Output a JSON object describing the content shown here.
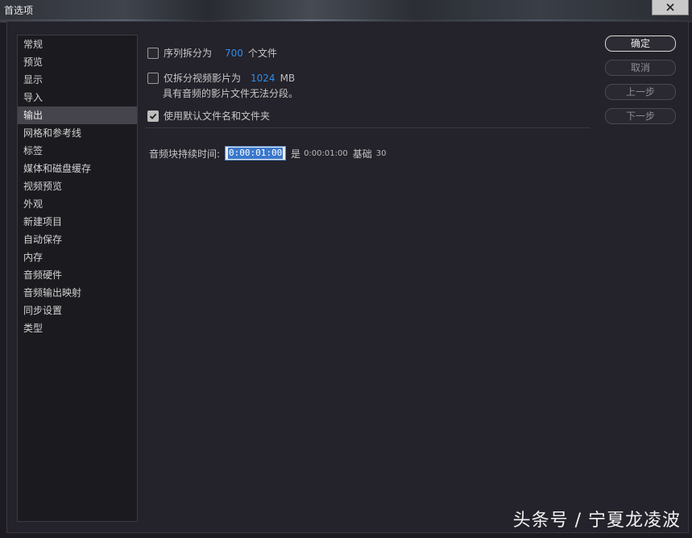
{
  "window": {
    "title": "首选项"
  },
  "sidebar": {
    "items": [
      {
        "label": "常规"
      },
      {
        "label": "预览"
      },
      {
        "label": "显示"
      },
      {
        "label": "导入"
      },
      {
        "label": "输出"
      },
      {
        "label": "网格和参考线"
      },
      {
        "label": "标签"
      },
      {
        "label": "媒体和磁盘缓存"
      },
      {
        "label": "视频预览"
      },
      {
        "label": "外观"
      },
      {
        "label": "新建项目"
      },
      {
        "label": "自动保存"
      },
      {
        "label": "内存"
      },
      {
        "label": "音频硬件"
      },
      {
        "label": "音频输出映射"
      },
      {
        "label": "同步设置"
      },
      {
        "label": "类型"
      }
    ],
    "selected": "输出"
  },
  "output": {
    "split_sequence": {
      "prefix": "序列拆分为",
      "value": "700",
      "suffix": "个文件",
      "checked": false
    },
    "split_video": {
      "prefix": "仅拆分视频影片为",
      "value": "1024",
      "unit": "MB",
      "note": "具有音频的影片文件无法分段。",
      "checked": false
    },
    "default_names": {
      "label": "使用默认文件名和文件夹",
      "checked": true
    },
    "audio_block": {
      "label": "音频块持续时间:",
      "value": "0:00:01:00",
      "is_label": "是",
      "is_value": "0:00:01:00",
      "base_label": "基础",
      "base_value": "30"
    }
  },
  "buttons": {
    "ok": "确定",
    "cancel": "取消",
    "prev": "上一步",
    "next": "下一步"
  },
  "watermark": "头条号 / 宁夏龙凌波"
}
